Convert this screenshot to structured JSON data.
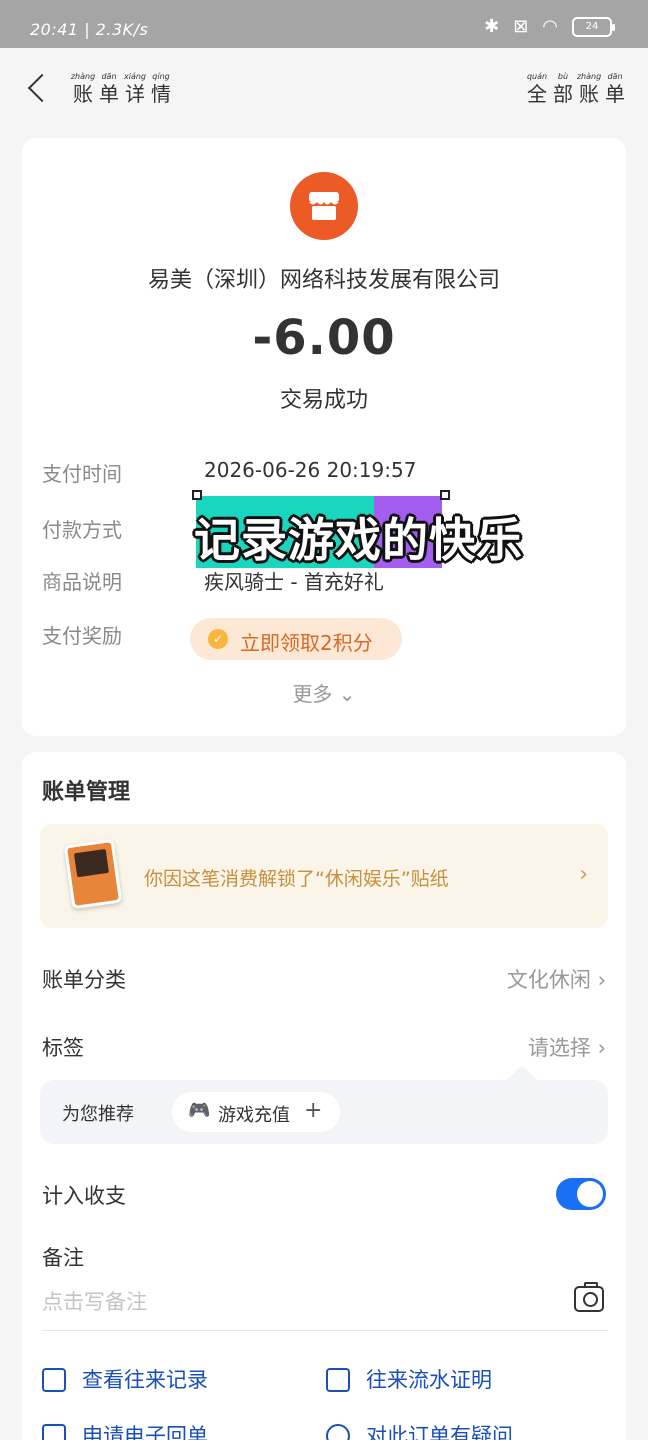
{
  "status_bar": {
    "time": "20:41 | 2.3K/s",
    "icons": [
      "bluetooth-icon",
      "sim-icon",
      "wifi-icon",
      "battery-icon"
    ],
    "battery_text": "24"
  },
  "nav": {
    "title": [
      {
        "py": "zhàng",
        "hz": "账"
      },
      {
        "py": "dān",
        "hz": "单"
      },
      {
        "py": "xiáng",
        "hz": "详"
      },
      {
        "py": "qíng",
        "hz": "情"
      }
    ],
    "right": [
      {
        "py": "quán",
        "hz": "全"
      },
      {
        "py": "bù",
        "hz": "部"
      },
      {
        "py": "zhàng",
        "hz": "账"
      },
      {
        "py": "dān",
        "hz": "单"
      }
    ]
  },
  "transaction": {
    "merchant": "易美（深圳）网络科技发展有限公司",
    "amount": "-6.00",
    "status": "交易成功",
    "rows": [
      {
        "label": "支付时间",
        "value": "2026-06-26 20:19:57"
      },
      {
        "label": "付款方式",
        "value": ""
      },
      {
        "label": "商品说明",
        "value": "疾风骑士 - 首充好礼"
      },
      {
        "label": "支付奖励",
        "value": ""
      }
    ],
    "reward": "立即领取2积分",
    "more": "更多"
  },
  "overlay": {
    "text": "记录游戏的快乐"
  },
  "bill_management": {
    "title": "账单管理",
    "sticker_text": "你因这笔消费解锁了“休闲娱乐”贴纸",
    "category_label": "账单分类",
    "category_value": "文化休闲",
    "tag_label": "标签",
    "tag_value": "请选择",
    "recommend_label": "为您推荐",
    "recommend_chip": "游戏充值",
    "include_label": "计入收支",
    "include_on": true,
    "remark_label": "备注",
    "remark_placeholder": "点击写备注",
    "links": [
      "查看往来记录",
      "往来流水证明",
      "申请电子回单",
      "对此订单有疑问"
    ]
  },
  "colors": {
    "accent_blue": "#1b6ff5",
    "logo_orange": "#ec5a26",
    "reward_orange": "#d56a24",
    "link_blue": "#1a4fb8"
  }
}
